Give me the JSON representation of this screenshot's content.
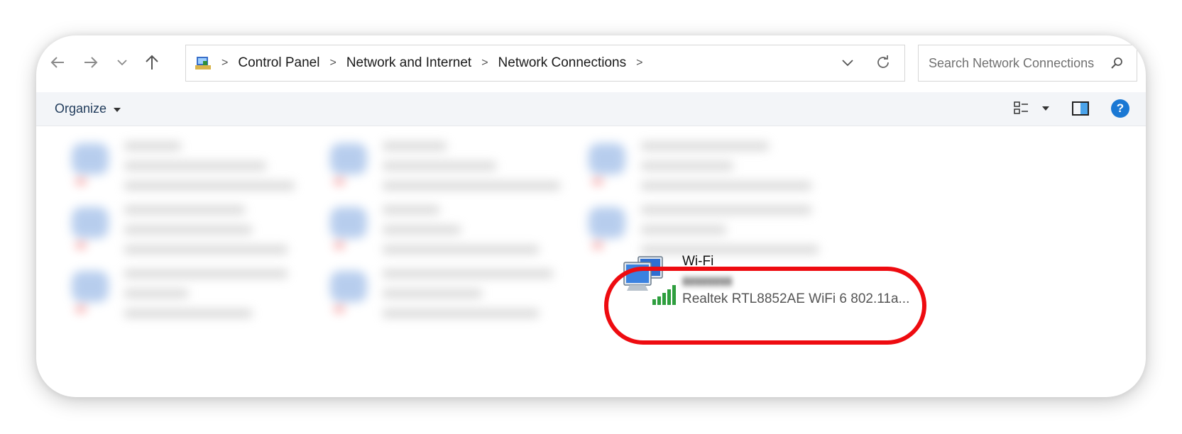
{
  "nav": {
    "back_icon": "arrow-left-icon",
    "forward_icon": "arrow-right-icon",
    "recent_icon": "chevron-down-icon",
    "up_icon": "arrow-up-icon"
  },
  "address_bar": {
    "root_icon": "control-panel-icon",
    "crumbs": [
      "Control Panel",
      "Network and Internet",
      "Network Connections"
    ],
    "dropdown_icon": "chevron-down-icon",
    "refresh_icon": "refresh-icon"
  },
  "search": {
    "placeholder": "Search Network Connections",
    "icon": "search-icon"
  },
  "command_bar": {
    "organize_label": "Organize",
    "view_icon": "view-options-icon",
    "preview_pane_icon": "preview-pane-icon",
    "help_label": "?"
  },
  "connections": {
    "wifi": {
      "name": "Wi-Fi",
      "adapter": "Realtek RTL8852AE WiFi 6 802.11a..."
    }
  },
  "colors": {
    "highlight": "#ee0b10",
    "help_button": "#1a78d4",
    "signal": "#2e9e3e"
  }
}
